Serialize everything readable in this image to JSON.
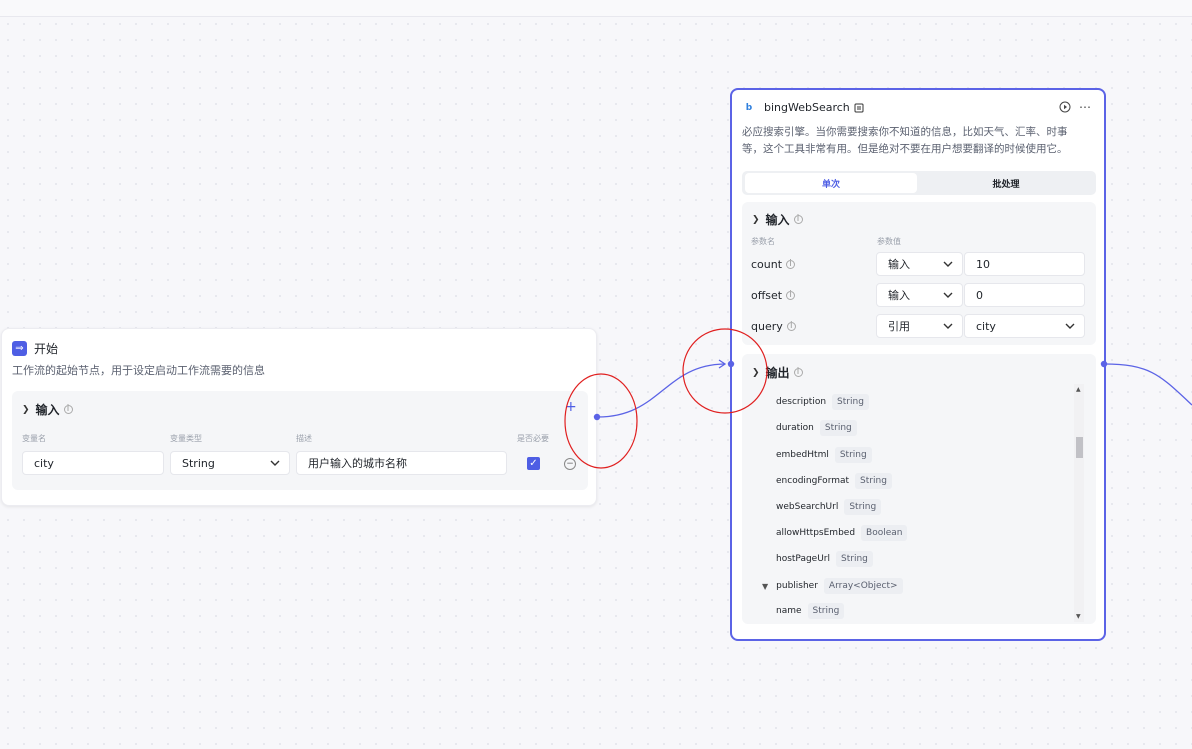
{
  "start_node": {
    "icon": "start-icon",
    "title": "开始",
    "description": "工作流的起始节点，用于设定启动工作流需要的信息",
    "input_section": "输入",
    "columns": [
      "变量名",
      "变量类型",
      "描述",
      "是否必要"
    ],
    "row": {
      "name": "city",
      "type": "String",
      "desc": "用户输入的城市名称",
      "required": true
    }
  },
  "bing_node": {
    "title": "bingWebSearch",
    "description_line1": "必应搜索引擎。当你需要搜索你不知道的信息，比如天气、汇率、时事",
    "description_line2": "等，这个工具非常有用。但是绝对不要在用户想要翻译的时候使用它。",
    "tabs": {
      "single": "单次",
      "batch": "批处理"
    },
    "input_section": "输入",
    "param_col": "参数名",
    "value_col": "参数值",
    "params": [
      {
        "name": "count",
        "mode": "输入",
        "value": "10"
      },
      {
        "name": "offset",
        "mode": "输入",
        "value": "0"
      },
      {
        "name": "query",
        "mode": "引用",
        "value": "city"
      }
    ],
    "output_section": "输出",
    "outputs": [
      {
        "name": "description",
        "type": "String"
      },
      {
        "name": "duration",
        "type": "String"
      },
      {
        "name": "embedHtml",
        "type": "String"
      },
      {
        "name": "encodingFormat",
        "type": "String"
      },
      {
        "name": "webSearchUrl",
        "type": "String"
      },
      {
        "name": "allowHttpsEmbed",
        "type": "Boolean"
      },
      {
        "name": "hostPageUrl",
        "type": "String"
      },
      {
        "name": "publisher",
        "type": "Array<Object>"
      },
      {
        "name": "name",
        "type": "String"
      }
    ]
  },
  "colors": {
    "accent": "#4e5ee4",
    "annotation": "#e02020",
    "edge": "#5b63e6"
  }
}
